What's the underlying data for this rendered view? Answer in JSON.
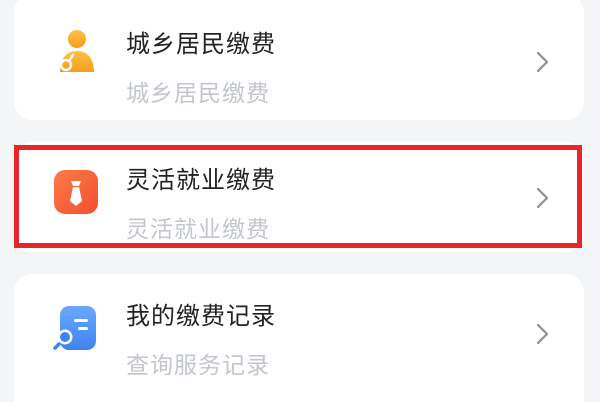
{
  "menu": {
    "items": [
      {
        "title": "城乡居民缴费",
        "subtitle": "城乡居民缴费",
        "icon": "resident-person-icon",
        "accent": "#f5a623"
      },
      {
        "title": "灵活就业缴费",
        "subtitle": "灵活就业缴费",
        "icon": "necktie-icon",
        "accent": "#f4623a"
      },
      {
        "title": "我的缴费记录",
        "subtitle": "查询服务记录",
        "icon": "record-search-icon",
        "accent": "#4a90f5"
      }
    ],
    "highlight_color": "#e8262a"
  }
}
